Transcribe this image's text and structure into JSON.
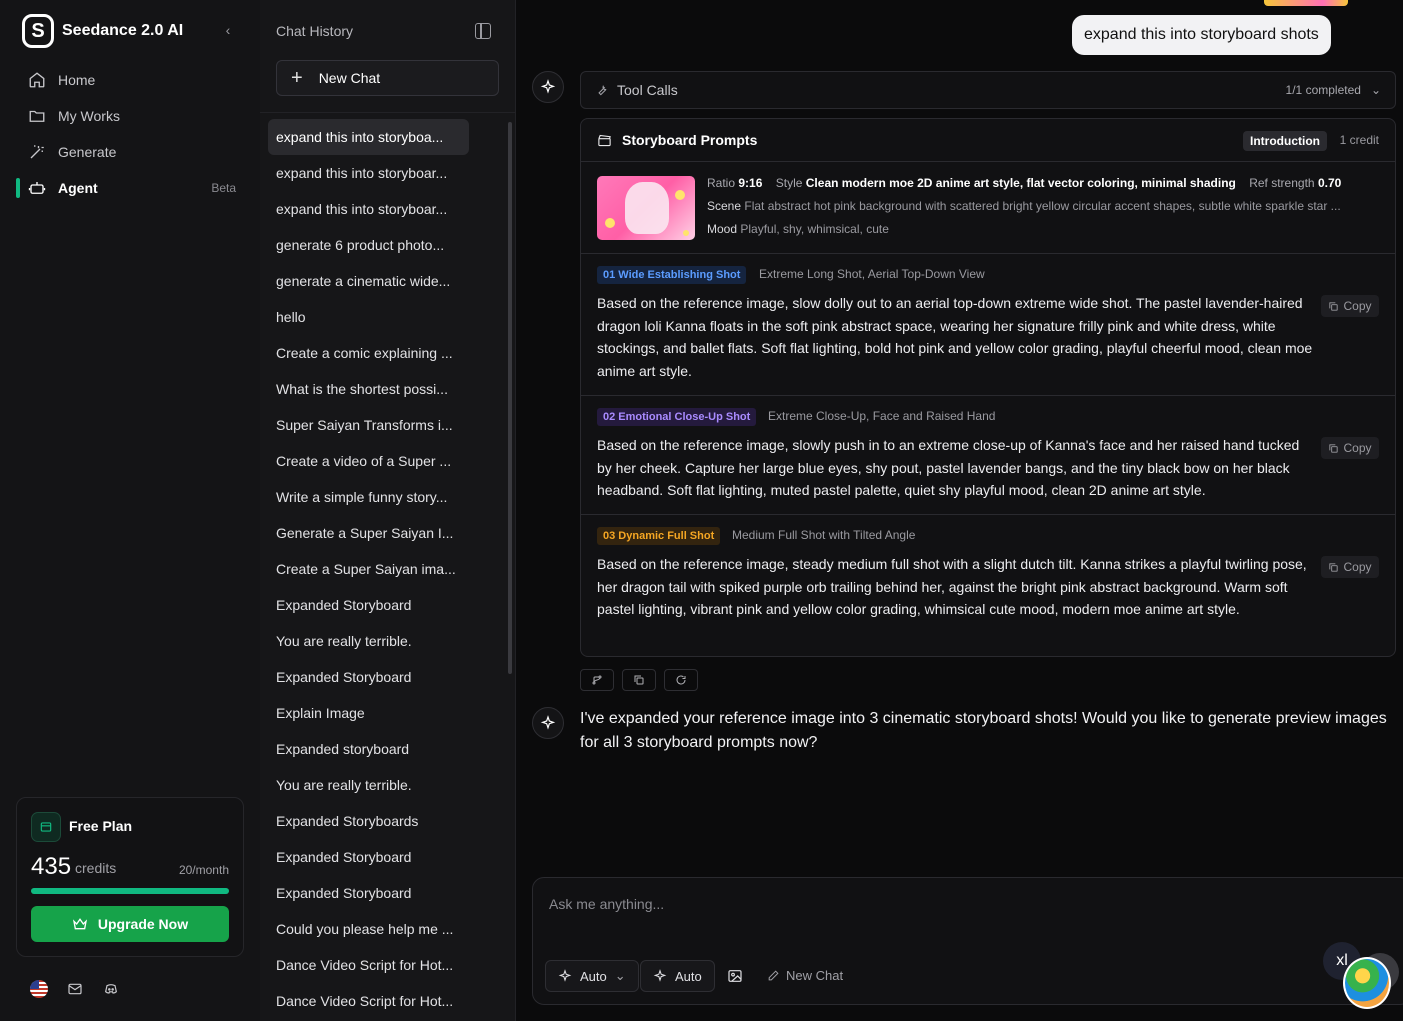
{
  "brand": {
    "name": "Seedance 2.0 AI",
    "logo_letter": "S"
  },
  "nav": {
    "items": [
      {
        "label": "Home",
        "icon": "home-icon"
      },
      {
        "label": "My Works",
        "icon": "folder-icon"
      },
      {
        "label": "Generate",
        "icon": "magic-wand-icon"
      },
      {
        "label": "Agent",
        "icon": "robot-icon",
        "badge": "Beta",
        "active": true
      }
    ]
  },
  "plan": {
    "name": "Free Plan",
    "credits": "435",
    "credits_label": "credits",
    "quota": "20/month",
    "progress": 1.0,
    "upgrade_label": "Upgrade Now",
    "accent": "#10b981"
  },
  "history": {
    "title": "Chat History",
    "new_chat_label": "New Chat",
    "items": [
      "expand this into storyboa...",
      "expand this into storyboar...",
      "expand this into storyboar...",
      "generate 6 product photo...",
      "generate a cinematic wide...",
      "hello",
      "Create a comic explaining ...",
      "What is the shortest possi...",
      "Super Saiyan Transforms i...",
      "Create a video of a Super ...",
      "Write a simple funny story...",
      "Generate a Super Saiyan I...",
      "Create a Super Saiyan ima...",
      "Expanded Storyboard",
      "You are really terrible.",
      "Expanded Storyboard",
      "Explain Image",
      "Expanded storyboard",
      "You are really terrible.",
      "Expanded Storyboards",
      "Expanded Storyboard",
      "Expanded Storyboard",
      "Could you please help me ...",
      "Dance Video Script for Hot...",
      "Dance Video Script for Hot..."
    ]
  },
  "chat": {
    "user_message": "expand this into storyboard shots",
    "tool_calls": {
      "label": "Tool Calls",
      "status": "1/1 completed"
    },
    "storyboard": {
      "title": "Storyboard Prompts",
      "badge": "Introduction",
      "credit": "1 credit",
      "meta": {
        "ratio_key": "Ratio",
        "ratio": "9:16",
        "style_key": "Style",
        "style": "Clean modern moe 2D anime art style, flat vector coloring, minimal shading",
        "ref_key": "Ref strength",
        "ref": "0.70",
        "scene_key": "Scene",
        "scene": "Flat abstract hot pink background with scattered bright yellow circular accent shapes, subtle white sparkle star ...",
        "mood_key": "Mood",
        "mood": "Playful, shy, whimsical, cute"
      },
      "shots": [
        {
          "tag": "01 Wide Establishing Shot",
          "subtitle": "Extreme Long Shot, Aerial Top-Down View",
          "text": "Based on the reference image, slow dolly out to an aerial top-down extreme wide shot. The pastel lavender-haired dragon loli Kanna floats in the soft pink abstract space, wearing her signature frilly pink and white dress, white stockings, and ballet flats. Soft flat lighting, bold hot pink and yellow color grading, playful cheerful mood, clean moe anime art style.",
          "copy": "Copy",
          "tag_bg": "#15243f",
          "tag_color": "#5b9cff"
        },
        {
          "tag": "02 Emotional Close-Up Shot",
          "subtitle": "Extreme Close-Up, Face and Raised Hand",
          "text": "Based on the reference image, slowly push in to an extreme close-up of Kanna's face and her raised hand tucked by her cheek. Capture her large blue eyes, shy pout, pastel lavender bangs, and the tiny black bow on her black headband. Soft flat lighting, muted pastel palette, quiet shy playful mood, clean 2D anime art style.",
          "copy": "Copy",
          "tag_bg": "#241a3d",
          "tag_color": "#a98bff"
        },
        {
          "tag": "03 Dynamic Full Shot",
          "subtitle": "Medium Full Shot with Tilted Angle",
          "text": "Based on the reference image, steady medium full shot with a slight dutch tilt. Kanna strikes a playful twirling pose, her dragon tail with spiked purple orb trailing behind her, against the bright pink abstract background. Warm soft pastel lighting, vibrant pink and yellow color grading, whimsical cute mood, modern moe anime art style.",
          "copy": "Copy",
          "tag_bg": "#33240f",
          "tag_color": "#f5a623"
        }
      ]
    },
    "ai_reply": "I've expanded your reference image into 3 cinematic storyboard shots! Would you like to generate preview images for all 3 storyboard prompts now?"
  },
  "composer": {
    "placeholder": "Ask me anything...",
    "model_label": "Auto",
    "mode_label": "Auto",
    "new_chat_label": "New Chat"
  },
  "floating": {
    "avatar_text": "xl"
  }
}
